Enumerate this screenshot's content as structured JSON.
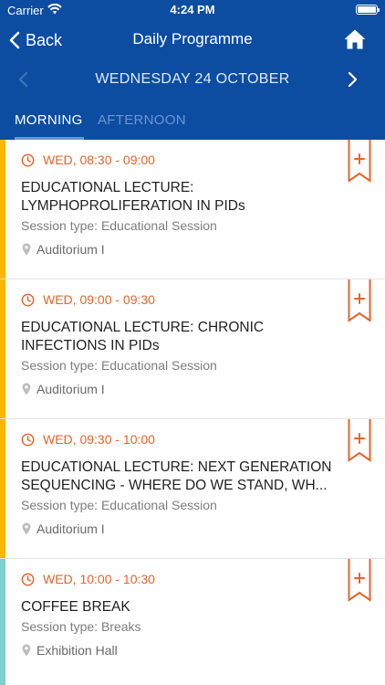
{
  "status_bar": {
    "carrier": "Carrier",
    "time": "4:24 PM"
  },
  "nav": {
    "back_label": "Back",
    "title": "Daily Programme",
    "home_icon": "home-icon"
  },
  "date_nav": {
    "label": "WEDNESDAY 24 OCTOBER"
  },
  "tabs": [
    {
      "label": "MORNING",
      "active": true
    },
    {
      "label": "AFTERNOON",
      "active": false
    }
  ],
  "colors": {
    "header": "#0c4da2",
    "accent_orange": "#e2652c",
    "stripe_yellow": "#f6b800",
    "stripe_teal": "#7fd0cb"
  },
  "sessions": [
    {
      "time": "WED, 08:30 - 09:00",
      "title_line1": "EDUCATIONAL LECTURE:",
      "title_line2": "LYMPHOPROLIFERATION IN PIDs",
      "type": "Session type: Educational Session",
      "location": "Auditorium I",
      "stripe": "#f6b800"
    },
    {
      "time": "WED, 09:00 - 09:30",
      "title_line1": "EDUCATIONAL LECTURE: CHRONIC",
      "title_line2": "INFECTIONS IN PIDs",
      "type": "Session type: Educational Session",
      "location": "Auditorium I",
      "stripe": "#f6b800"
    },
    {
      "time": "WED, 09:30 - 10:00",
      "title_line1": "EDUCATIONAL LECTURE: NEXT GENERATION",
      "title_line2": "SEQUENCING - WHERE DO WE STAND, WH...",
      "type": "Session type: Educational Session",
      "location": "Auditorium I",
      "stripe": "#f6b800"
    },
    {
      "time": "WED, 10:00 - 10:30",
      "title_line1": "COFFEE BREAK",
      "title_line2": "",
      "type": "Session type: Breaks",
      "location": "Exhibition Hall",
      "stripe": "#7fd0cb"
    }
  ]
}
